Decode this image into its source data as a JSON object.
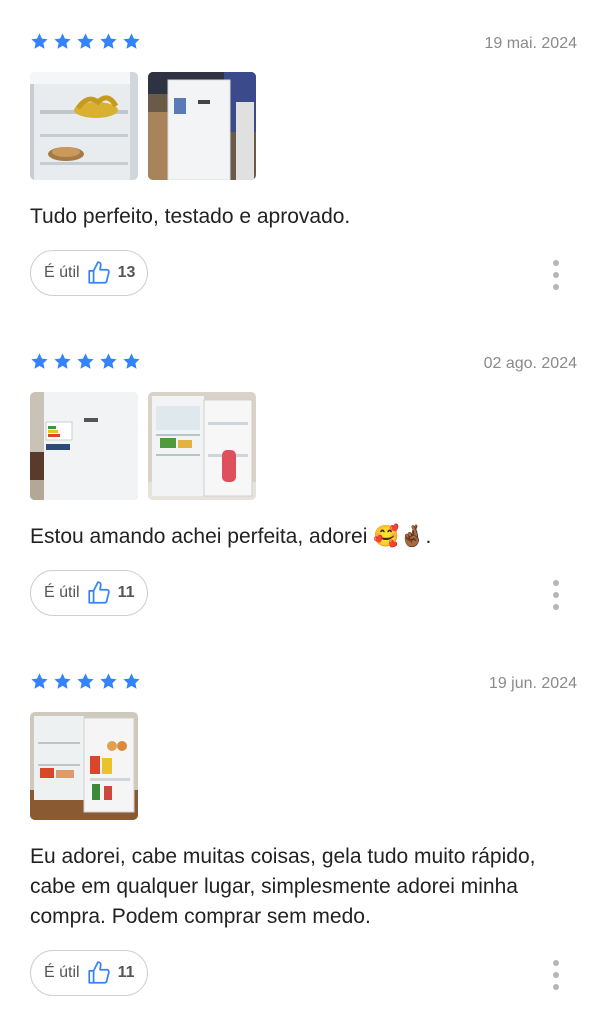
{
  "accent_color": "#3483fa",
  "reviews": [
    {
      "rating": 5,
      "date": "19 mai. 2024",
      "photos": [
        "fridge-interior-bananas",
        "fridge-exterior-store"
      ],
      "text": "Tudo perfeito, testado e aprovado.",
      "useful_label": "É útil",
      "useful_count": "13"
    },
    {
      "rating": 5,
      "date": "02 ago. 2024",
      "photos": [
        "fridge-exterior-closed",
        "fridge-open-door"
      ],
      "text": "Estou amando achei perfeita, adorei 🥰🤞🏾.",
      "useful_label": "É útil",
      "useful_count": "11"
    },
    {
      "rating": 5,
      "date": "19 jun. 2024",
      "photos": [
        "fridge-open-full"
      ],
      "text": "Eu adorei, cabe muitas coisas, gela tudo muito rápido, cabe em qualquer lugar, simplesmente adorei minha compra. Podem comprar sem medo.",
      "useful_label": "É útil",
      "useful_count": "11"
    }
  ]
}
